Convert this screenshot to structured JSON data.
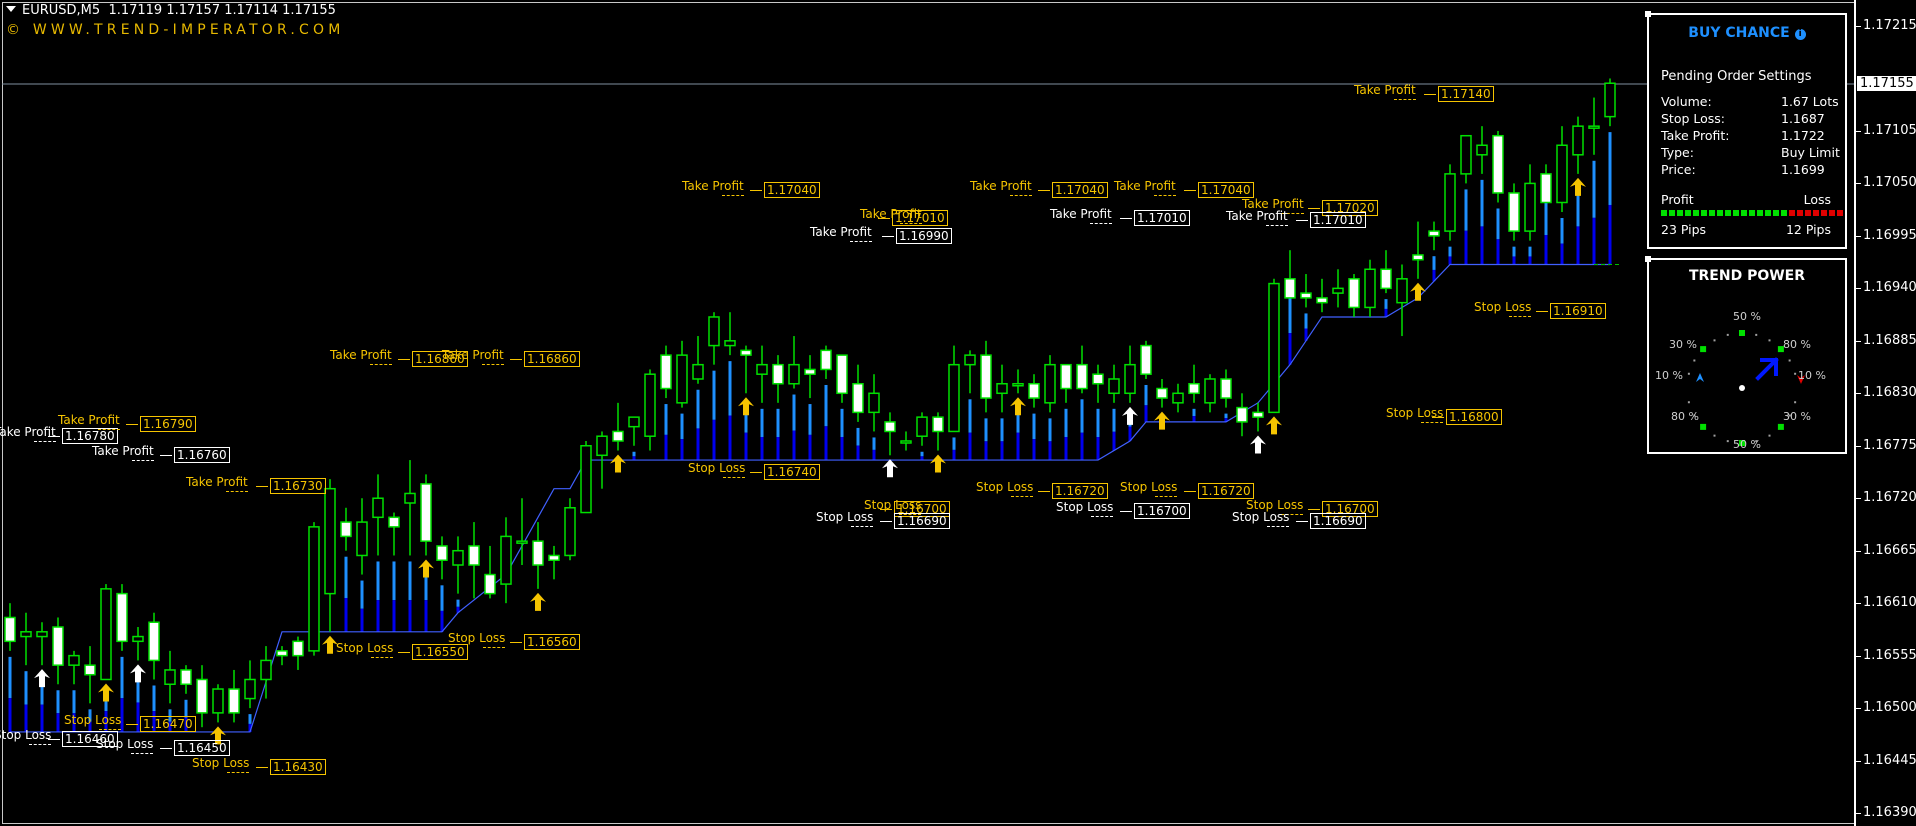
{
  "window": {
    "symbol_timeframe": "EURUSD,M5",
    "ohlc": "1.17119 1.17157 1.17114 1.17155",
    "brand": "© WWW.TREND-IMPERATOR.COM"
  },
  "price_axis": {
    "labels": [
      "1.17215",
      "1.17105",
      "1.17050",
      "1.16995",
      "1.16940",
      "1.16885",
      "1.16830",
      "1.16775",
      "1.16720",
      "1.16665",
      "1.16610",
      "1.16555",
      "1.16500",
      "1.16445",
      "1.16390"
    ],
    "current_price": "1.17155"
  },
  "colors": {
    "bull_candle": "#00e000",
    "bear_candle_fill": "#ffffff",
    "histogram_light": "#1e90ff",
    "histogram_dark": "#0000ee",
    "trail_line": "#4060ff",
    "label_yellow": "#f5c400",
    "label_white": "#ffffff",
    "buy_chance_title": "#1e90ff",
    "profit_green": "#00e000",
    "loss_red": "#e00000"
  },
  "buy_chance_panel": {
    "title": "BUY CHANCE",
    "info_icon": "i",
    "subtitle": "Pending Order Settings",
    "rows": [
      {
        "label": "Volume:",
        "value": "1.67 Lots"
      },
      {
        "label": "Stop Loss:",
        "value": "1.1687"
      },
      {
        "label": "Take Profit:",
        "value": "1.1722"
      },
      {
        "label": "Type:",
        "value": "Buy Limit"
      },
      {
        "label": "Price:",
        "value": "1.1699"
      }
    ],
    "profit_label": "Profit",
    "loss_label": "Loss",
    "profit_value": "23 Pips",
    "loss_value": "12 Pips",
    "profit_blocks": 16,
    "loss_blocks": 7
  },
  "trend_power_panel": {
    "title": "TREND POWER",
    "top": "50 %",
    "top_left": "30 %",
    "top_right": "80 %",
    "left": "10 %",
    "right": "10 %",
    "bottom_left": "80 %",
    "bottom_right": "30 %",
    "bottom": "50 %",
    "direction": "up-right"
  },
  "annotations": [
    {
      "kind": "Take Profit",
      "text": "Take Profit",
      "value": "1.16780",
      "color": "white"
    },
    {
      "kind": "Take Profit",
      "text": "Take Profit",
      "value": "1.16790",
      "color": "yellow"
    },
    {
      "kind": "Take Profit",
      "text": "Take Profit",
      "value": "1.16760",
      "color": "white"
    },
    {
      "kind": "Take Profit",
      "text": "Take Profit",
      "value": "1.16730",
      "color": "yellow"
    },
    {
      "kind": "Take Profit",
      "text": "Take Profit",
      "value": "1.16860",
      "color": "yellow"
    },
    {
      "kind": "Take Profit",
      "text": "Take Profit",
      "value": "1.16860",
      "color": "yellow"
    },
    {
      "kind": "Take Profit",
      "text": "Take Profit",
      "value": "1.17040",
      "color": "yellow"
    },
    {
      "kind": "Take Profit",
      "text": "Take Profit",
      "value": "1.17010",
      "color": "yellow"
    },
    {
      "kind": "Take Profit",
      "text": "Take Profit",
      "value": "1.16990",
      "color": "white"
    },
    {
      "kind": "Take Profit",
      "text": "Take Profit",
      "value": "1.17040",
      "color": "yellow"
    },
    {
      "kind": "Take Profit",
      "text": "Take Profit",
      "value": "1.17010",
      "color": "white"
    },
    {
      "kind": "Take Profit",
      "text": "Take Profit",
      "value": "1.17040",
      "color": "yellow"
    },
    {
      "kind": "Take Profit",
      "text": "Take Profit",
      "value": "1.17020",
      "color": "yellow"
    },
    {
      "kind": "Take Profit",
      "text": "Take Profit",
      "value": "1.17010",
      "color": "white"
    },
    {
      "kind": "Take Profit",
      "text": "Take Profit",
      "value": "1.17140",
      "color": "yellow"
    },
    {
      "kind": "Stop Loss",
      "text": "Stop Loss",
      "value": "1.16460",
      "color": "white"
    },
    {
      "kind": "Stop Loss",
      "text": "Stop Loss",
      "value": "1.16470",
      "color": "yellow"
    },
    {
      "kind": "Stop Loss",
      "text": "Stop Loss",
      "value": "1.16450",
      "color": "white"
    },
    {
      "kind": "Stop Loss",
      "text": "Stop Loss",
      "value": "1.16430",
      "color": "yellow"
    },
    {
      "kind": "Stop Loss",
      "text": "Stop Loss",
      "value": "1.16550",
      "color": "yellow"
    },
    {
      "kind": "Stop Loss",
      "text": "Stop Loss",
      "value": "1.16560",
      "color": "yellow"
    },
    {
      "kind": "Stop Loss",
      "text": "Stop Loss",
      "value": "1.16740",
      "color": "yellow"
    },
    {
      "kind": "Stop Loss",
      "text": "Stop Loss",
      "value": "1.16700",
      "color": "yellow"
    },
    {
      "kind": "Stop Loss",
      "text": "Stop Loss",
      "value": "1.16690",
      "color": "white"
    },
    {
      "kind": "Stop Loss",
      "text": "Stop Loss",
      "value": "1.16720",
      "color": "yellow"
    },
    {
      "kind": "Stop Loss",
      "text": "Stop Loss",
      "value": "1.16700",
      "color": "white"
    },
    {
      "kind": "Stop Loss",
      "text": "Stop Loss",
      "value": "1.16720",
      "color": "yellow"
    },
    {
      "kind": "Stop Loss",
      "text": "Stop Loss",
      "value": "1.16700",
      "color": "yellow"
    },
    {
      "kind": "Stop Loss",
      "text": "Stop Loss",
      "value": "1.16690",
      "color": "white"
    },
    {
      "kind": "Stop Loss",
      "text": "Stop Loss",
      "value": "1.16800",
      "color": "yellow"
    },
    {
      "kind": "Stop Loss",
      "text": "Stop Loss",
      "value": "1.16910",
      "color": "yellow"
    }
  ],
  "chart_data": {
    "type": "candlestick",
    "symbol": "EURUSD",
    "timeframe": "M5",
    "ylim": [
      1.16375,
      1.1724
    ],
    "current_price": 1.17155,
    "candles": [
      [
        1.16595,
        1.1661,
        1.1656,
        1.1657
      ],
      [
        1.16575,
        1.166,
        1.16545,
        1.1658
      ],
      [
        1.16575,
        1.1659,
        1.16545,
        1.1658
      ],
      [
        1.16585,
        1.16595,
        1.16525,
        1.16545
      ],
      [
        1.16545,
        1.1656,
        1.16525,
        1.16555
      ],
      [
        1.16545,
        1.16565,
        1.16505,
        1.16535
      ],
      [
        1.1653,
        1.1663,
        1.1653,
        1.16625
      ],
      [
        1.1662,
        1.1663,
        1.1656,
        1.1657
      ],
      [
        1.1657,
        1.16585,
        1.1655,
        1.16575
      ],
      [
        1.1659,
        1.166,
        1.1653,
        1.1655
      ],
      [
        1.16525,
        1.1656,
        1.16505,
        1.1654
      ],
      [
        1.1654,
        1.16545,
        1.16515,
        1.16525
      ],
      [
        1.1653,
        1.16545,
        1.1648,
        1.16495
      ],
      [
        1.16495,
        1.16525,
        1.16485,
        1.1652
      ],
      [
        1.1652,
        1.1654,
        1.16485,
        1.16495
      ],
      [
        1.1651,
        1.1655,
        1.165,
        1.1653
      ],
      [
        1.1653,
        1.16565,
        1.1651,
        1.1655
      ],
      [
        1.1656,
        1.16565,
        1.16545,
        1.16555
      ],
      [
        1.1657,
        1.16575,
        1.1654,
        1.16555
      ],
      [
        1.1656,
        1.16695,
        1.16555,
        1.1669
      ],
      [
        1.1662,
        1.1674,
        1.1658,
        1.1673
      ],
      [
        1.16695,
        1.1671,
        1.16665,
        1.1668
      ],
      [
        1.1666,
        1.1672,
        1.1664,
        1.16695
      ],
      [
        1.167,
        1.16745,
        1.1666,
        1.1672
      ],
      [
        1.167,
        1.16705,
        1.1666,
        1.1669
      ],
      [
        1.16715,
        1.1676,
        1.1666,
        1.16725
      ],
      [
        1.16735,
        1.16745,
        1.1666,
        1.16675
      ],
      [
        1.1667,
        1.1668,
        1.16635,
        1.16655
      ],
      [
        1.1665,
        1.1668,
        1.1662,
        1.16665
      ],
      [
        1.1667,
        1.16695,
        1.16615,
        1.1665
      ],
      [
        1.1664,
        1.1667,
        1.16615,
        1.1662
      ],
      [
        1.1663,
        1.167,
        1.1661,
        1.1668
      ],
      [
        1.16675,
        1.1672,
        1.1665,
        1.16675
      ],
      [
        1.16675,
        1.16695,
        1.16625,
        1.1665
      ],
      [
        1.1666,
        1.1667,
        1.16635,
        1.16655
      ],
      [
        1.1666,
        1.1672,
        1.16655,
        1.1671
      ],
      [
        1.16705,
        1.1678,
        1.16705,
        1.16775
      ],
      [
        1.16765,
        1.1679,
        1.1673,
        1.16785
      ],
      [
        1.1679,
        1.1682,
        1.1677,
        1.1678
      ],
      [
        1.16795,
        1.16805,
        1.16775,
        1.16805
      ],
      [
        1.16785,
        1.16855,
        1.1677,
        1.1685
      ],
      [
        1.1687,
        1.1688,
        1.16825,
        1.16835
      ],
      [
        1.1682,
        1.16885,
        1.16815,
        1.1687
      ],
      [
        1.16845,
        1.1689,
        1.1684,
        1.1686
      ],
      [
        1.1688,
        1.16915,
        1.1686,
        1.1691
      ],
      [
        1.1688,
        1.16915,
        1.1687,
        1.16885
      ],
      [
        1.16875,
        1.1688,
        1.1683,
        1.1687
      ],
      [
        1.1685,
        1.1688,
        1.1682,
        1.1686
      ],
      [
        1.1686,
        1.1687,
        1.1682,
        1.1684
      ],
      [
        1.1684,
        1.1689,
        1.16835,
        1.1686
      ],
      [
        1.16855,
        1.1687,
        1.16825,
        1.1685
      ],
      [
        1.16875,
        1.1688,
        1.16845,
        1.16855
      ],
      [
        1.1687,
        1.1687,
        1.1682,
        1.1683
      ],
      [
        1.1684,
        1.1686,
        1.168,
        1.1681
      ],
      [
        1.1681,
        1.1685,
        1.1679,
        1.1683
      ],
      [
        1.168,
        1.1681,
        1.16765,
        1.1679
      ],
      [
        1.1678,
        1.1679,
        1.1677,
        1.1678
      ],
      [
        1.16785,
        1.1681,
        1.16775,
        1.16805
      ],
      [
        1.16805,
        1.1681,
        1.1677,
        1.1679
      ],
      [
        1.1679,
        1.1688,
        1.1679,
        1.1686
      ],
      [
        1.1686,
        1.16875,
        1.1683,
        1.1687
      ],
      [
        1.1687,
        1.16885,
        1.1681,
        1.16825
      ],
      [
        1.1683,
        1.1686,
        1.1681,
        1.1684
      ],
      [
        1.1684,
        1.16855,
        1.1683,
        1.1684
      ],
      [
        1.1684,
        1.1685,
        1.16815,
        1.16825
      ],
      [
        1.1682,
        1.1687,
        1.1681,
        1.1686
      ],
      [
        1.1686,
        1.1686,
        1.1682,
        1.16835
      ],
      [
        1.1686,
        1.1688,
        1.1683,
        1.16835
      ],
      [
        1.1685,
        1.1686,
        1.1682,
        1.1684
      ],
      [
        1.1683,
        1.1686,
        1.1682,
        1.16845
      ],
      [
        1.1683,
        1.1688,
        1.1682,
        1.1686
      ],
      [
        1.1688,
        1.16885,
        1.16845,
        1.1685
      ],
      [
        1.16835,
        1.16845,
        1.16815,
        1.16825
      ],
      [
        1.1682,
        1.1684,
        1.1681,
        1.1683
      ],
      [
        1.1684,
        1.1686,
        1.1682,
        1.1683
      ],
      [
        1.1682,
        1.1685,
        1.1681,
        1.16845
      ],
      [
        1.16845,
        1.16855,
        1.16815,
        1.16825
      ],
      [
        1.16815,
        1.1683,
        1.16785,
        1.168
      ],
      [
        1.1681,
        1.1682,
        1.1679,
        1.16805
      ],
      [
        1.1681,
        1.1695,
        1.1681,
        1.16945
      ],
      [
        1.1695,
        1.1698,
        1.1694,
        1.1693
      ],
      [
        1.16935,
        1.16955,
        1.1692,
        1.1693
      ],
      [
        1.1693,
        1.1695,
        1.16915,
        1.16925
      ],
      [
        1.16935,
        1.1696,
        1.1692,
        1.1694
      ],
      [
        1.1695,
        1.16955,
        1.1691,
        1.1692
      ],
      [
        1.1692,
        1.1697,
        1.1691,
        1.1696
      ],
      [
        1.1696,
        1.1698,
        1.16935,
        1.1694
      ],
      [
        1.16925,
        1.16965,
        1.1689,
        1.1695
      ],
      [
        1.16975,
        1.1701,
        1.1695,
        1.1697
      ],
      [
        1.17,
        1.1701,
        1.1698,
        1.16995
      ],
      [
        1.17,
        1.1707,
        1.1699,
        1.1706
      ],
      [
        1.1706,
        1.1709,
        1.1705,
        1.171
      ],
      [
        1.1708,
        1.1711,
        1.1706,
        1.1709
      ],
      [
        1.171,
        1.17105,
        1.1703,
        1.1704
      ],
      [
        1.1704,
        1.1705,
        1.1699,
        1.17
      ],
      [
        1.17,
        1.1707,
        1.1699,
        1.1705
      ],
      [
        1.1706,
        1.1707,
        1.1704,
        1.1703
      ],
      [
        1.1703,
        1.1711,
        1.1702,
        1.1709
      ],
      [
        1.1708,
        1.1712,
        1.1706,
        1.1711
      ],
      [
        1.1711,
        1.1714,
        1.1708,
        1.1711
      ],
      [
        1.1712,
        1.1716,
        1.1711,
        1.17155
      ]
    ],
    "signal_arrows": [
      {
        "index": 2,
        "color": "white"
      },
      {
        "index": 6,
        "color": "yellow"
      },
      {
        "index": 8,
        "color": "white"
      },
      {
        "index": 13,
        "color": "yellow"
      },
      {
        "index": 20,
        "color": "yellow"
      },
      {
        "index": 26,
        "color": "yellow"
      },
      {
        "index": 33,
        "color": "yellow"
      },
      {
        "index": 38,
        "color": "yellow"
      },
      {
        "index": 46,
        "color": "yellow"
      },
      {
        "index": 55,
        "color": "white"
      },
      {
        "index": 58,
        "color": "yellow"
      },
      {
        "index": 63,
        "color": "yellow"
      },
      {
        "index": 70,
        "color": "white"
      },
      {
        "index": 72,
        "color": "yellow"
      },
      {
        "index": 78,
        "color": "white"
      },
      {
        "index": 79,
        "color": "yellow"
      },
      {
        "index": 88,
        "color": "yellow"
      },
      {
        "index": 98,
        "color": "yellow"
      }
    ],
    "trailing_stop": [
      [
        0,
        1.16475
      ],
      [
        15,
        1.16475
      ],
      [
        17,
        1.1658
      ],
      [
        26,
        1.1658
      ],
      [
        27,
        1.1658
      ],
      [
        28,
        1.166
      ],
      [
        31,
        1.1664
      ],
      [
        33,
        1.167
      ],
      [
        34,
        1.1673
      ],
      [
        35,
        1.1673
      ],
      [
        36,
        1.1676
      ],
      [
        37,
        1.1676
      ],
      [
        39,
        1.1676
      ],
      [
        42,
        1.1676
      ],
      [
        68,
        1.1676
      ],
      [
        70,
        1.1678
      ],
      [
        71,
        1.168
      ],
      [
        76,
        1.168
      ],
      [
        78,
        1.1682
      ],
      [
        80,
        1.1686
      ],
      [
        82,
        1.1691
      ],
      [
        86,
        1.1691
      ],
      [
        88,
        1.1693
      ],
      [
        90,
        1.16965
      ],
      [
        91,
        1.16965
      ]
    ],
    "y_tick_labels": [
      "1.17215",
      "1.17105",
      "1.17050",
      "1.16995",
      "1.16940",
      "1.16885",
      "1.16830",
      "1.16775",
      "1.16720",
      "1.16665",
      "1.16610",
      "1.16555",
      "1.16500",
      "1.16445",
      "1.16390"
    ]
  }
}
